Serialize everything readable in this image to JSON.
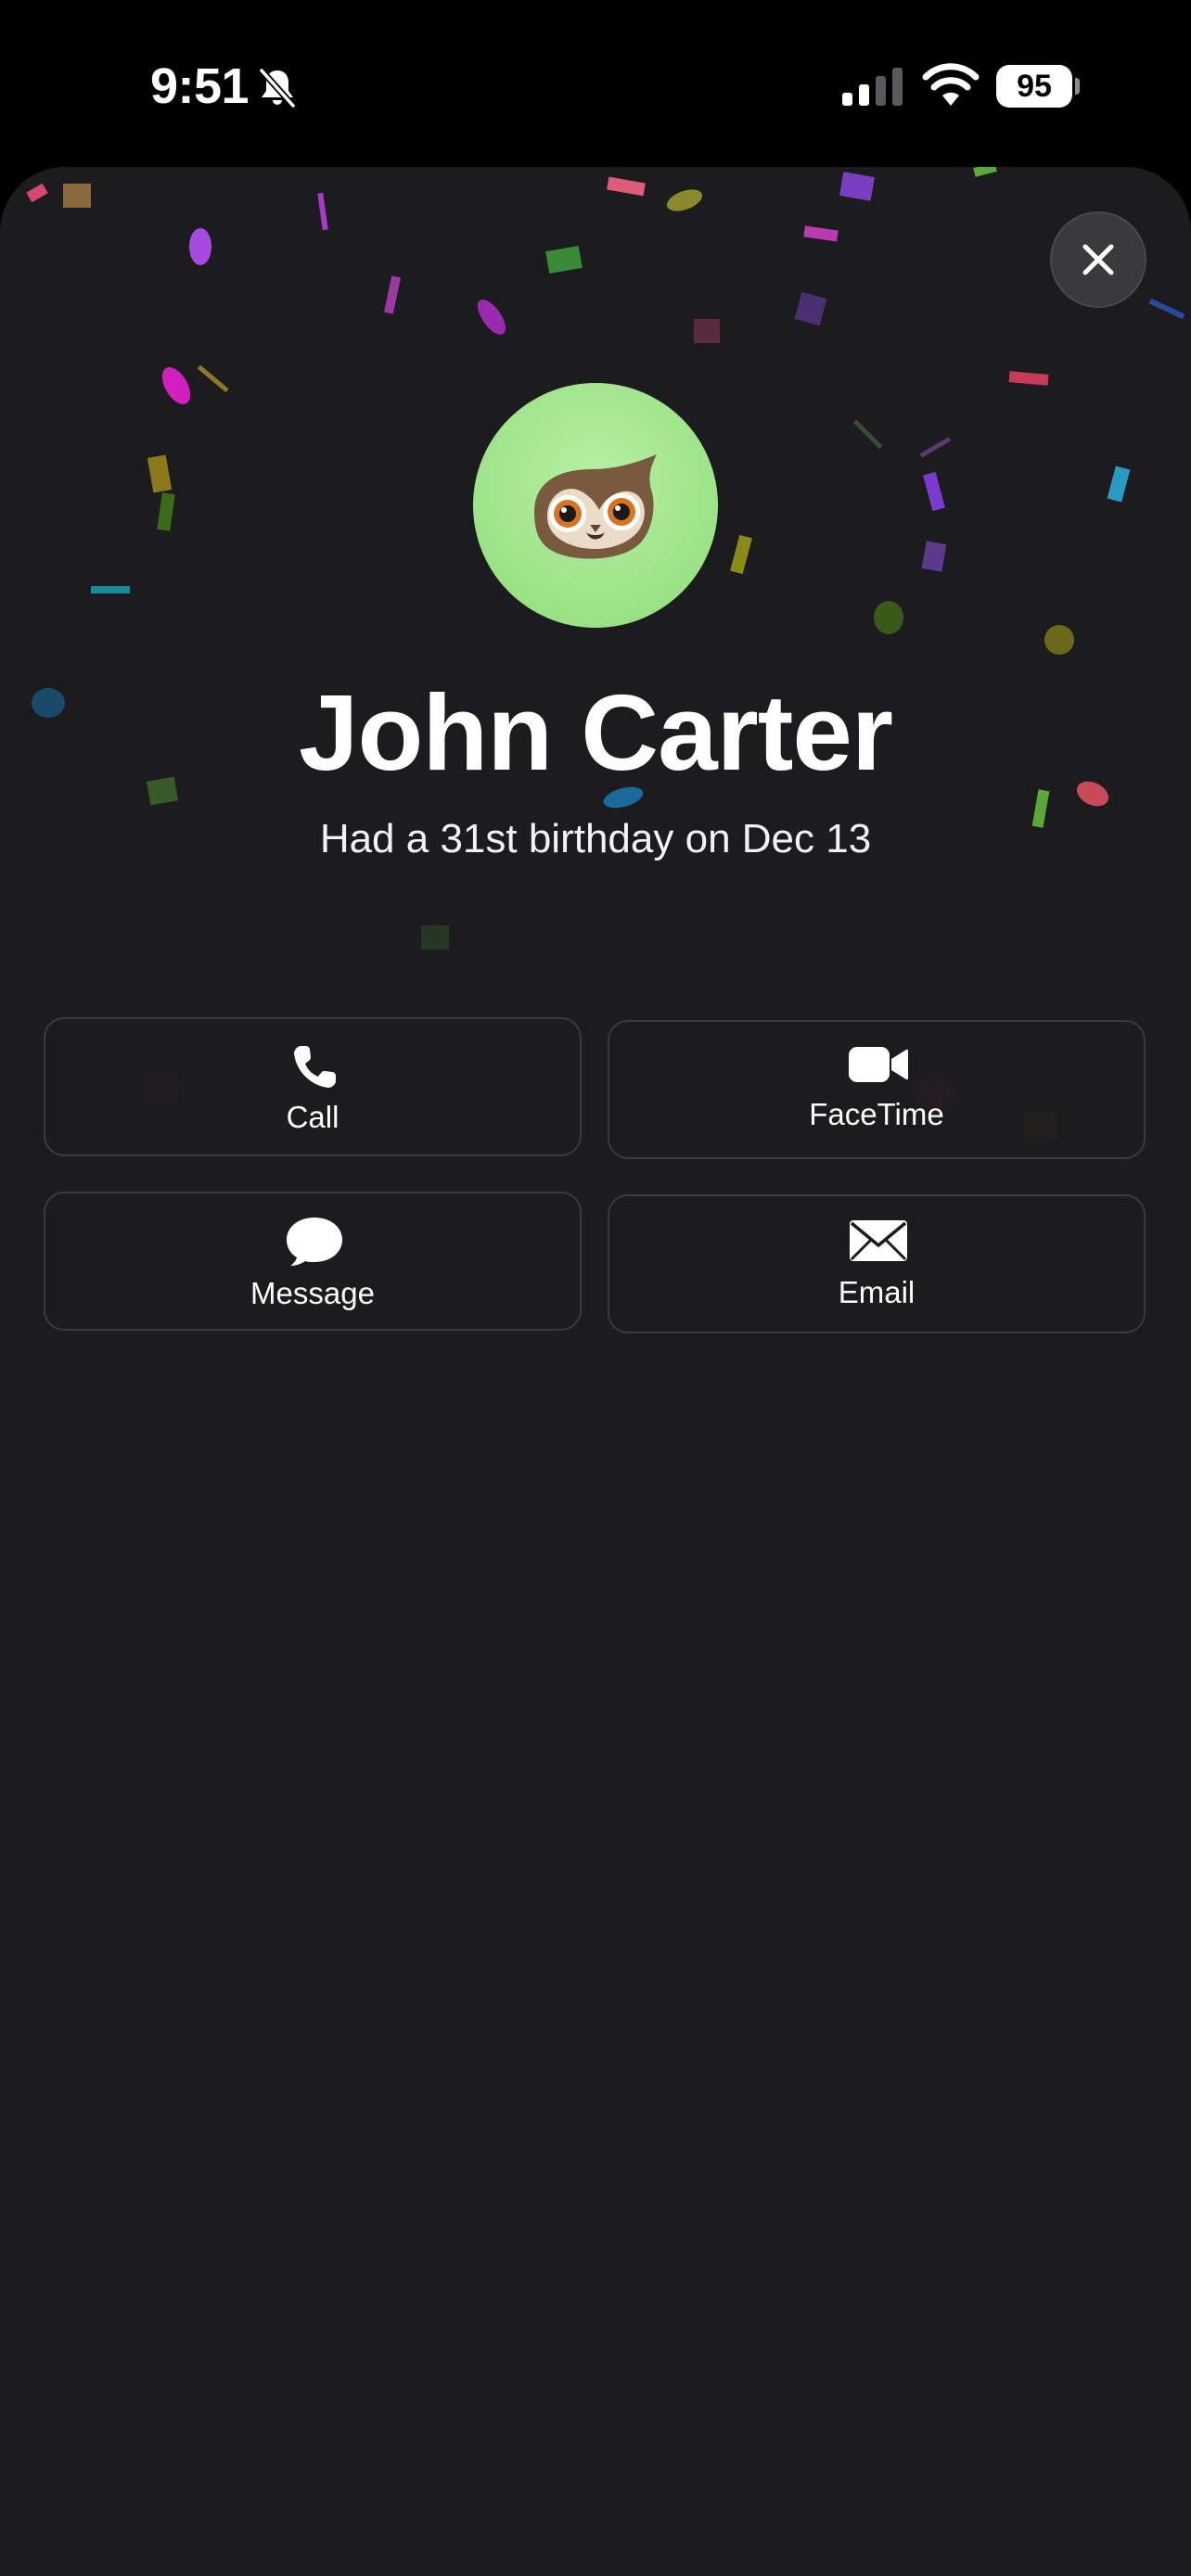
{
  "status_bar": {
    "time": "9:51",
    "battery_level": "95",
    "silent_mode_icon": "bell-slash-icon",
    "signal_icon": "cellular-signal-icon",
    "wifi_icon": "wifi-icon"
  },
  "contact": {
    "name": "John Carter",
    "subtitle": "Had a 31st birthday on Dec 13",
    "avatar_icon": "owl-memoji-icon",
    "avatar_color": "#9be387"
  },
  "actions": {
    "call": {
      "label": "Call",
      "icon": "phone-icon"
    },
    "facetime": {
      "label": "FaceTime",
      "icon": "video-camera-icon"
    },
    "message": {
      "label": "Message",
      "icon": "speech-bubble-icon"
    },
    "email": {
      "label": "Email",
      "icon": "envelope-icon"
    }
  },
  "close_icon": "close-icon",
  "colors": {
    "background": "#1c1c1e",
    "button_border": "#3a3a3c"
  }
}
